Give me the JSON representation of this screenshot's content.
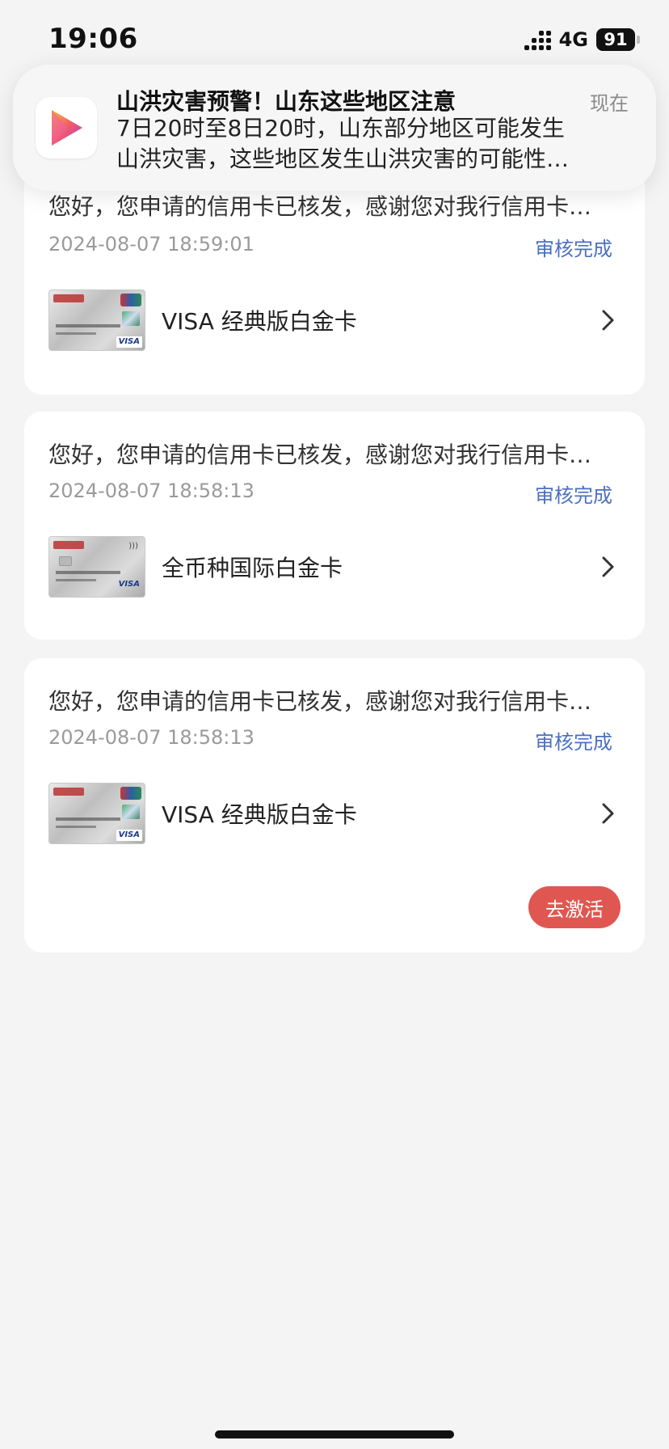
{
  "status_bar": {
    "time": "19:06",
    "network": "4G",
    "battery": "91"
  },
  "notification": {
    "app_icon": "video-play-icon",
    "title": "山洪灾害预警！山东这些地区注意",
    "time": "现在",
    "body_line1": "7日20时至8日20时，山东部分地区可能发生",
    "body_line2": "山洪灾害，这些地区发生山洪灾害的可能性…"
  },
  "cards": [
    {
      "message": "您好，您申请的信用卡已核发，感谢您对我行信用卡…",
      "time": "2024-08-07 18:59:01",
      "status": "审核完成",
      "product_name": "VISA 经典版白金卡"
    },
    {
      "message": "您好，您申请的信用卡已核发，感谢您对我行信用卡…",
      "time": "2024-08-07 18:58:13",
      "status": "审核完成",
      "product_name": "全币种国际白金卡"
    },
    {
      "message": "您好，您申请的信用卡已核发，感谢您对我行信用卡…",
      "time": "2024-08-07 18:58:13",
      "status": "审核完成",
      "product_name": "VISA 经典版白金卡",
      "action_label": "去激活"
    }
  ],
  "colors": {
    "status_link": "#4b6fc1",
    "activate_button": "#e05752",
    "background": "#f4f4f4"
  }
}
